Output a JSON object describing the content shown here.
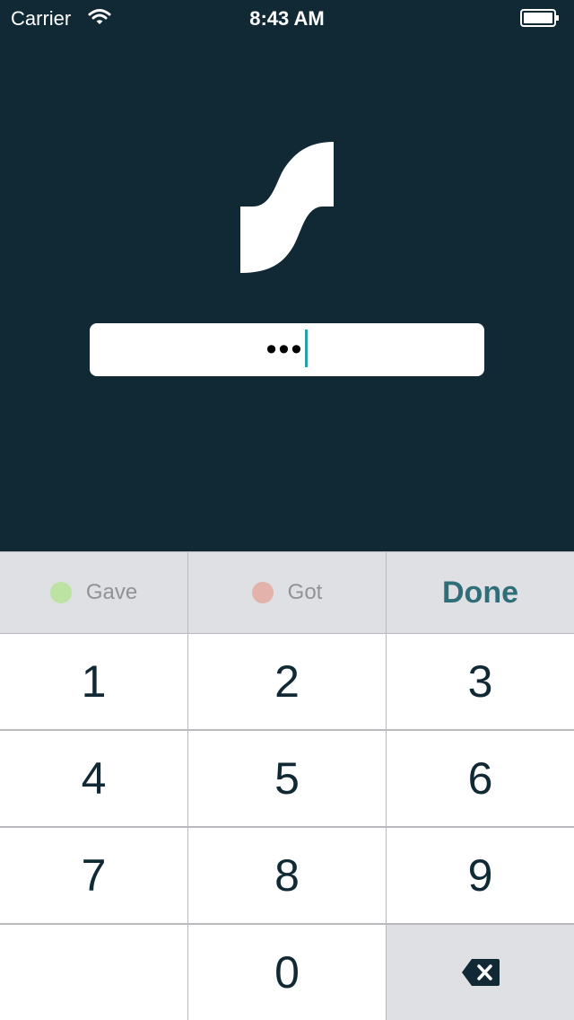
{
  "status_bar": {
    "carrier": "Carrier",
    "time": "8:43 AM",
    "wifi_icon": "wifi-icon",
    "battery_icon": "battery-icon"
  },
  "logo_icon": "swish-logo-icon",
  "passcode": {
    "value": "•••",
    "caret_color": "#27a0a6"
  },
  "toolbar": {
    "gave_label": "Gave",
    "gave_color": "#bde3a3",
    "got_label": "Got",
    "got_color": "#e2b2ab",
    "done_label": "Done",
    "done_color": "#2f6e79"
  },
  "keypad": {
    "keys": [
      "1",
      "2",
      "3",
      "4",
      "5",
      "6",
      "7",
      "8",
      "9",
      "",
      "0"
    ],
    "backspace_icon": "backspace-icon"
  },
  "colors": {
    "background": "#102935",
    "key_background": "#ffffff",
    "function_key_background": "#dfe0e4"
  }
}
